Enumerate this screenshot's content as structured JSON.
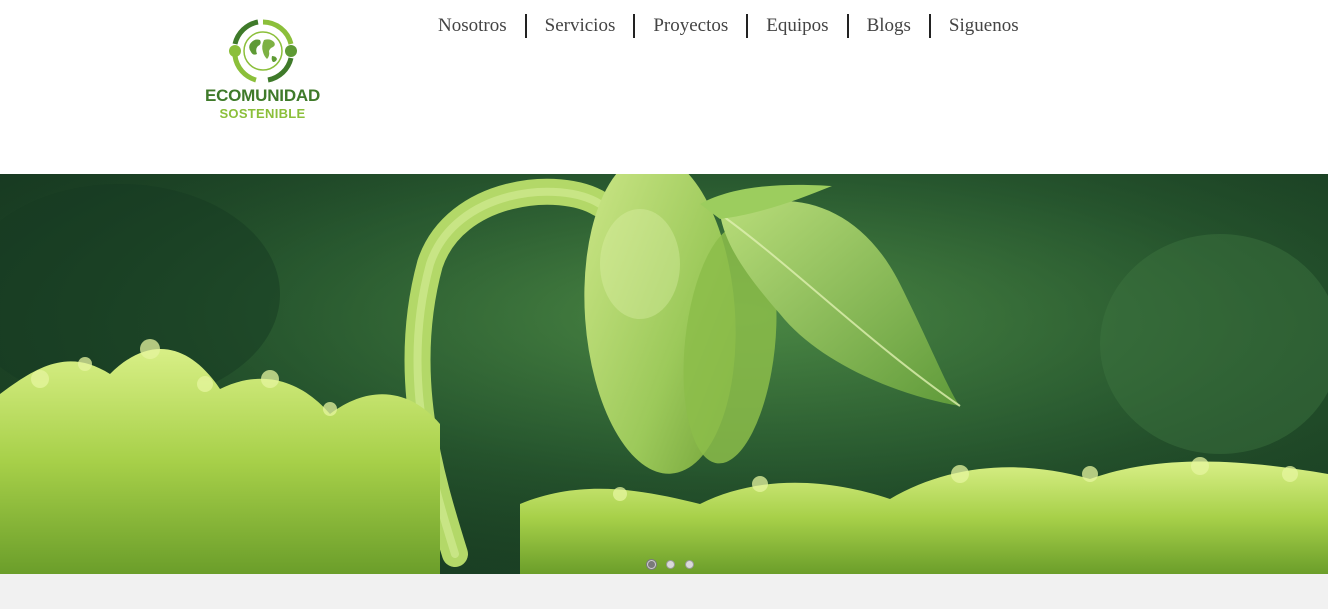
{
  "logo": {
    "title": "ECOMUNIDAD",
    "subtitle": "SOSTENIBLE",
    "icon": "globe-recycle-icon",
    "colors": {
      "dark_green": "#3f7a2a",
      "light_green": "#8bbf3a"
    }
  },
  "nav": {
    "items": [
      {
        "label": "Nosotros"
      },
      {
        "label": "Servicios"
      },
      {
        "label": "Proyectos"
      },
      {
        "label": "Equipos"
      },
      {
        "label": "Blogs"
      },
      {
        "label": "Siguenos"
      }
    ]
  },
  "hero": {
    "slides_count": 3,
    "active_slide": 1,
    "colors": {
      "background": "#1f4a2a",
      "sprout": "#9cc95a",
      "moss": "#b8dc5a"
    }
  },
  "colors": {
    "footer_band": "#f1f1f1",
    "nav_text": "#444444"
  }
}
